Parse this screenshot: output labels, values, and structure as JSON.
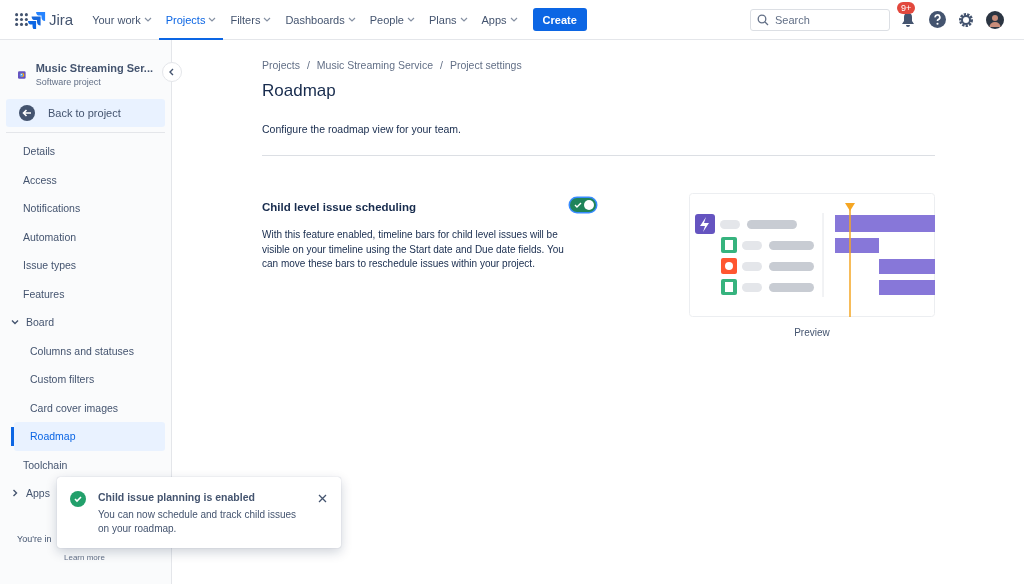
{
  "topbar": {
    "product": "Jira",
    "nav": [
      {
        "label": "Your work",
        "selected": false
      },
      {
        "label": "Projects",
        "selected": true
      },
      {
        "label": "Filters",
        "selected": false
      },
      {
        "label": "Dashboards",
        "selected": false
      },
      {
        "label": "People",
        "selected": false
      },
      {
        "label": "Plans",
        "selected": false
      },
      {
        "label": "Apps",
        "selected": false
      }
    ],
    "create": "Create",
    "search": {
      "placeholder": "Search"
    },
    "notification_badge": "9+"
  },
  "sidebar": {
    "project_name": "Music Streaming Ser...",
    "project_type": "Software project",
    "back": "Back to project",
    "items": [
      {
        "kind": "item",
        "label": "Details",
        "selected": false
      },
      {
        "kind": "item",
        "label": "Access",
        "selected": false
      },
      {
        "kind": "item",
        "label": "Notifications",
        "selected": false
      },
      {
        "kind": "item",
        "label": "Automation",
        "selected": false
      },
      {
        "kind": "item",
        "label": "Issue types",
        "selected": false
      },
      {
        "kind": "item",
        "label": "Features",
        "selected": false
      },
      {
        "kind": "group",
        "label": "Board",
        "expanded": true,
        "children": [
          {
            "label": "Columns and statuses",
            "selected": false
          },
          {
            "label": "Custom filters",
            "selected": false
          },
          {
            "label": "Card cover images",
            "selected": false
          },
          {
            "label": "Roadmap",
            "selected": true
          }
        ]
      },
      {
        "kind": "item",
        "label": "Toolchain",
        "selected": false
      },
      {
        "kind": "group",
        "label": "Apps",
        "expanded": false
      }
    ],
    "footer_text": "You're in",
    "footer_link": "Learn more"
  },
  "breadcrumbs": [
    "Projects",
    "/",
    "Music Streaming Service",
    "/",
    "Project settings"
  ],
  "title": "Roadmap",
  "description": "Configure the roadmap view for your team.",
  "setting": {
    "title": "Child level issue scheduling",
    "on": true,
    "text": "With this feature enabled, timeline bars for child level issues will be visible on your timeline using the Start date and Due date fields. You can move these bars to reschedule issues within your project.",
    "preview_label": "Preview"
  },
  "toast": {
    "title": "Child issue planning is enabled",
    "text": "You can now schedule and track child issues on your roadmap."
  }
}
